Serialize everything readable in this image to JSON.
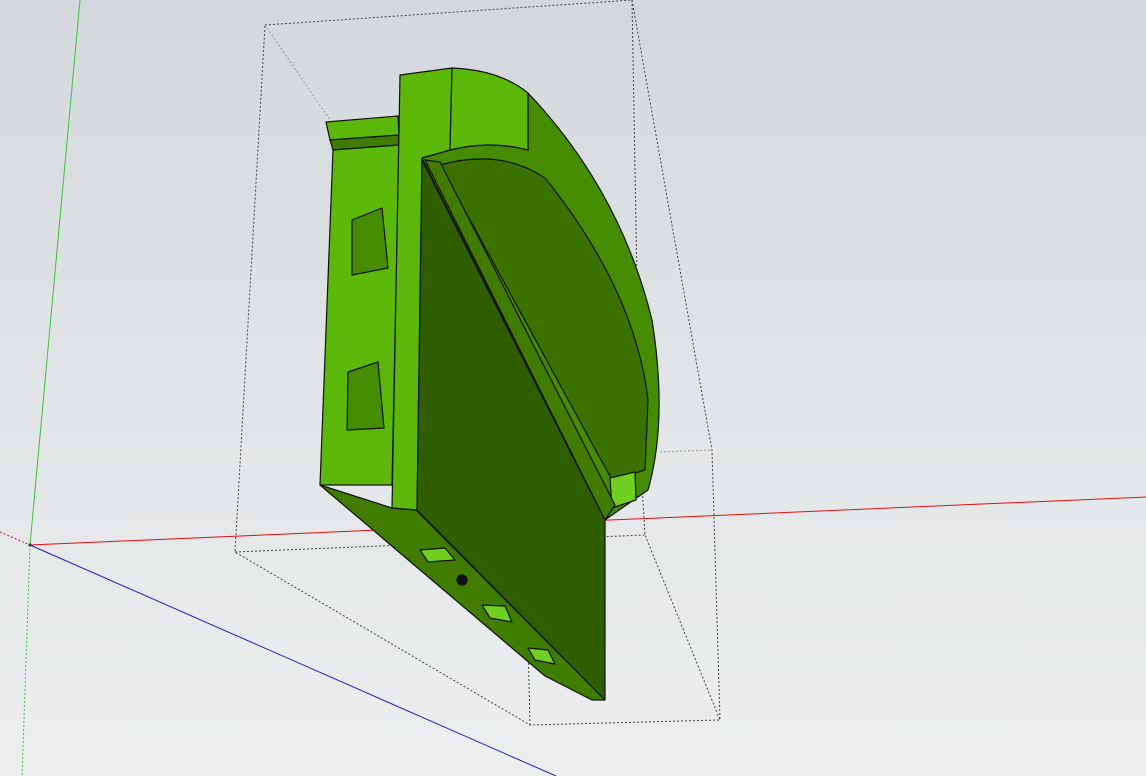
{
  "viewport": {
    "type": "3d-modeling-canvas",
    "colors": {
      "axis_red": "#e01010",
      "axis_green": "#30c030",
      "axis_blue": "#2020d0",
      "face_light": "#5cb808",
      "face_mid": "#468c00",
      "face_dark": "#2e5e00",
      "edge": "#111111",
      "bounding_box": "#555555"
    },
    "icons": [
      "axis-origin-icon"
    ]
  }
}
